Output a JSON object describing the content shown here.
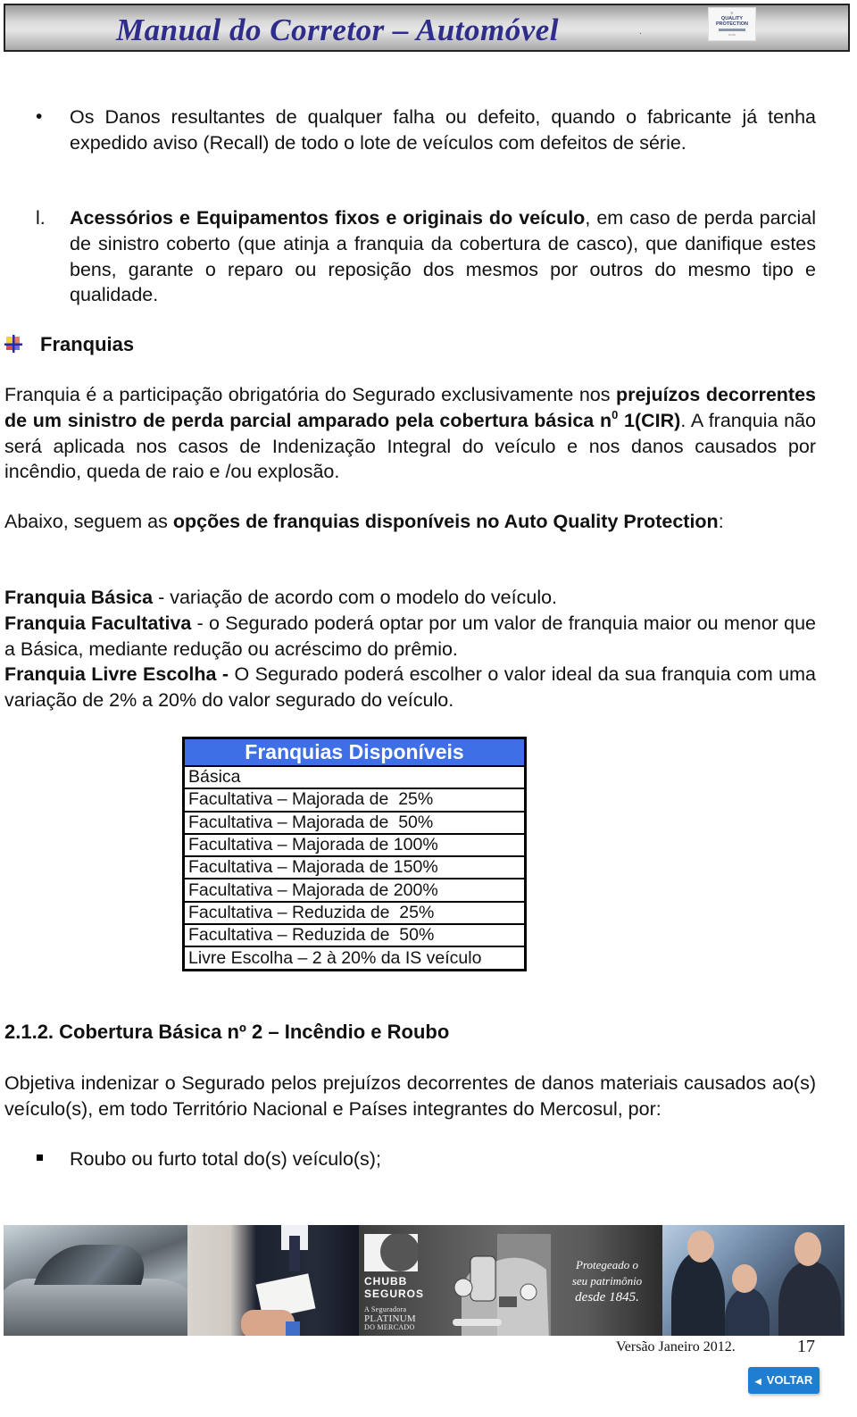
{
  "header": {
    "title": "Manual do Corretor – Automóvel",
    "dot": ".",
    "logo": {
      "line1": "≡",
      "line2a": "QUALITY",
      "line2b": "PROTECTION",
      "line3": "Auto"
    }
  },
  "bullet1": {
    "text": "Os Danos resultantes de qualquer falha ou defeito, quando o fabricante já tenha expedido aviso (Recall) de todo o lote de veículos com defeitos de série."
  },
  "item_l": {
    "marker": "l.",
    "bold": "Acessórios e Equipamentos fixos e originais do veículo",
    "rest": ", em caso de perda parcial de sinistro coberto (que atinja a franquia da cobertura de casco), que danifique estes bens, garante o reparo ou reposição dos mesmos por outros do mesmo tipo e qualidade."
  },
  "franquias_section": {
    "heading": "Franquias",
    "p1": {
      "a": "Franquia é a participação obrigatória do Segurado exclusivamente nos ",
      "b": "prejuízos decorrentes de um sinistro de perda parcial amparado pela cobertura básica n",
      "sup": "0",
      "c": " 1(CIR)",
      "d": ". A franquia não será aplicada nos casos de Indenização Integral do veículo e nos danos causados por incêndio, queda de raio e /ou explosão."
    },
    "p2": {
      "a": "Abaixo, seguem as ",
      "b": "opções de franquias disponíveis no Auto Quality Protection",
      "c": ":"
    },
    "types": [
      {
        "name": "Franquia Básica",
        "desc": " - variação de acordo com o modelo do veículo."
      },
      {
        "name": "Franquia Facultativa",
        "desc": " - o Segurado poderá optar por um valor de franquia maior ou menor que a Básica, mediante redução ou acréscimo do prêmio."
      },
      {
        "name": "Franquia Livre Escolha -",
        "desc": " O Segurado poderá escolher o valor ideal da sua franquia com uma variação de 2% a 20% do valor segurado do veículo."
      }
    ],
    "table": {
      "header": "Franquias Disponíveis",
      "header_color": "#3f6fe6",
      "rows": [
        "Básica",
        "Facultativa – Majorada de  25%",
        "Facultativa – Majorada de  50%",
        "Facultativa – Majorada de 100%",
        "Facultativa – Majorada de 150%",
        "Facultativa – Majorada de 200%",
        "Facultativa – Reduzida de  25%",
        "Facultativa – Reduzida de  50%",
        "Livre Escolha – 2 à 20% da IS veículo"
      ]
    }
  },
  "section_212": {
    "heading": "2.1.2. Cobertura Básica nº 2 – Incêndio e Roubo",
    "p1": "Objetiva indenizar o Segurado pelos prejuízos decorrentes de danos materiais causados ao(s) veículo(s), em todo Território Nacional e Países integrantes do Mercosul, por:",
    "bullets": [
      "Roubo ou furto total do(s) veículo(s);"
    ]
  },
  "banner": {
    "brand_line1": "CHUBB",
    "brand_line2": "SEGUROS",
    "tag_line1": "A Seguradora",
    "tag_line2": "PLATINUM",
    "tag_line3": "DO MERCADO",
    "slogan_line1": "Protegeado o",
    "slogan_line2": "seu patrimônio",
    "slogan_line3": "desde 1845."
  },
  "footer": {
    "version": "Versão Janeiro 2012.",
    "page_number": "17",
    "back_label": "VOLTAR",
    "back_color": "#1f7ecf"
  }
}
